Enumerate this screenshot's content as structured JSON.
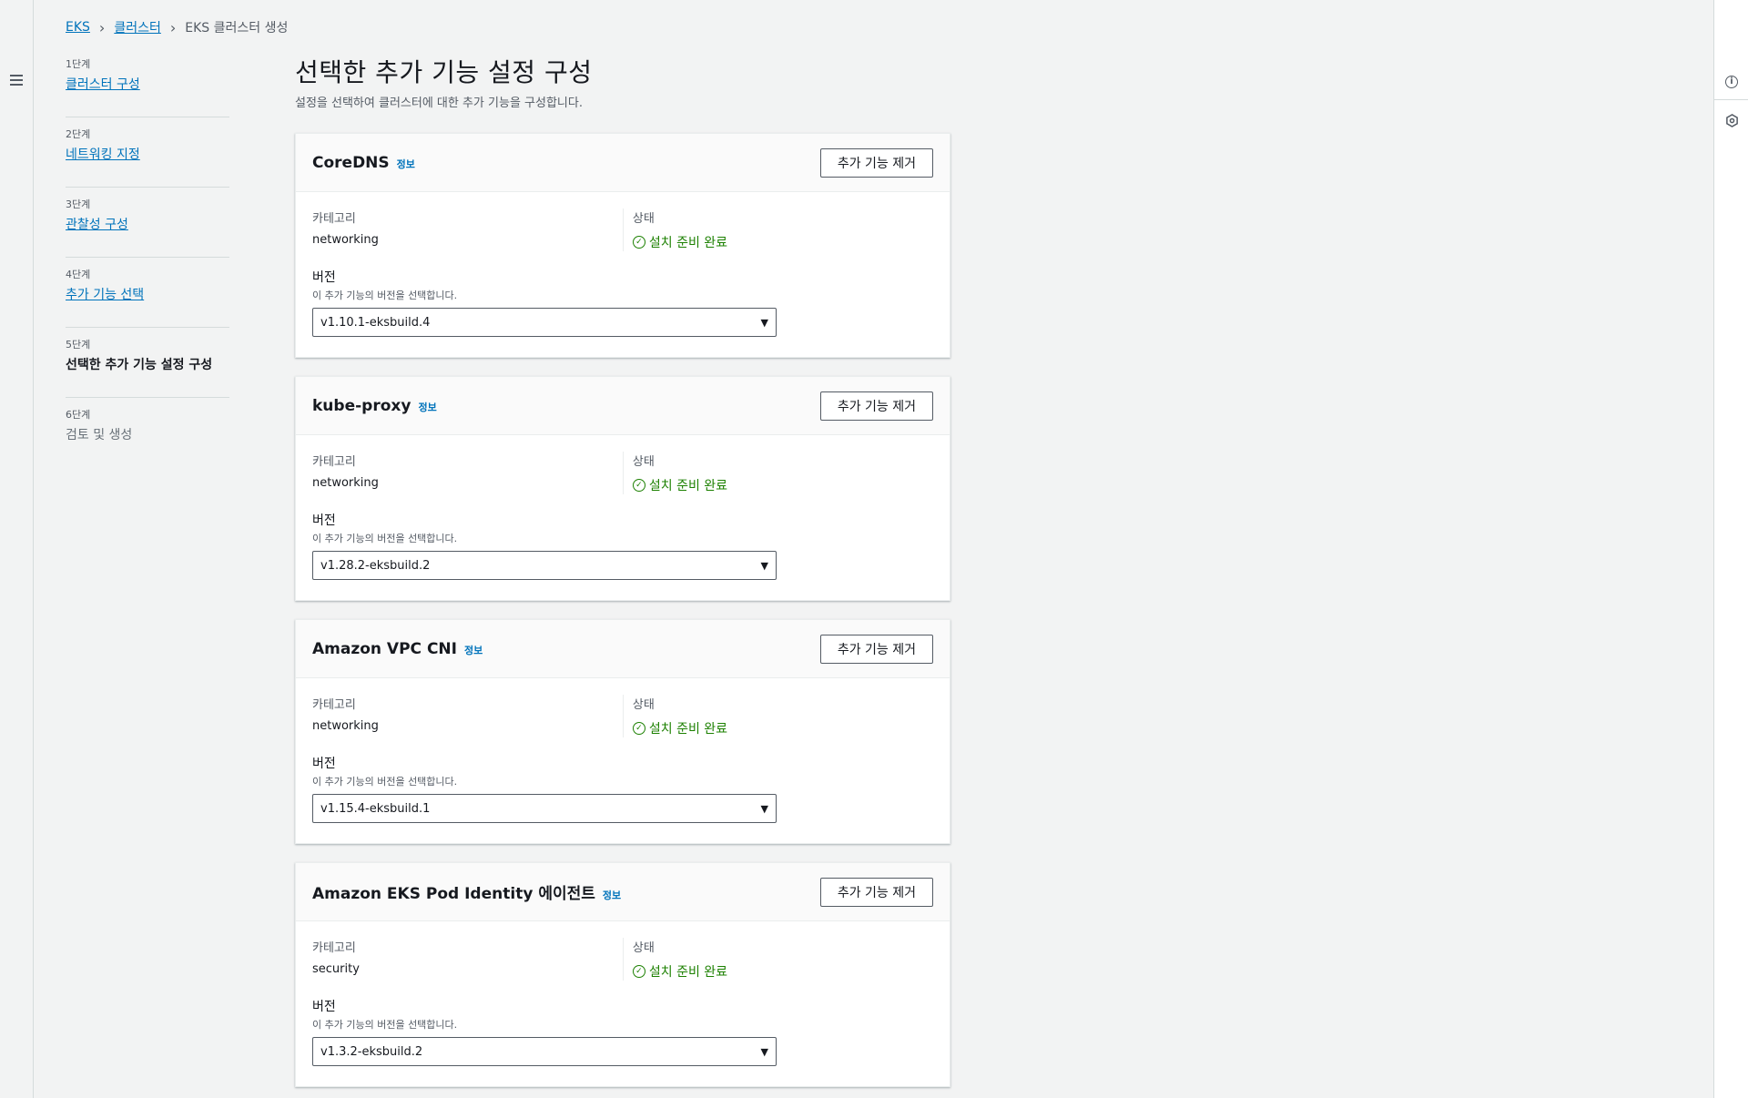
{
  "breadcrumb": {
    "items": [
      "EKS",
      "클러스터"
    ],
    "current": "EKS 클러스터 생성"
  },
  "steps": [
    {
      "num": "1단계",
      "label": "클러스터 구성",
      "state": "link"
    },
    {
      "num": "2단계",
      "label": "네트워킹 지정",
      "state": "link"
    },
    {
      "num": "3단계",
      "label": "관찰성 구성",
      "state": "link"
    },
    {
      "num": "4단계",
      "label": "추가 기능 선택",
      "state": "link"
    },
    {
      "num": "5단계",
      "label": "선택한 추가 기능 설정 구성",
      "state": "current"
    },
    {
      "num": "6단계",
      "label": "검토 및 생성",
      "state": "disabled"
    }
  ],
  "page": {
    "title": "선택한 추가 기능 설정 구성",
    "description": "설정을 선택하여 클러스터에 대한 추가 기능을 구성합니다."
  },
  "labels": {
    "info": "정보",
    "remove": "추가 기능 제거",
    "category": "카테고리",
    "status": "상태",
    "version": "버전",
    "version_desc": "이 추가 기능의 버전을 선택합니다."
  },
  "addons": [
    {
      "name": "CoreDNS",
      "category": "networking",
      "status": "설치 준비 완료",
      "version": "v1.10.1-eksbuild.4"
    },
    {
      "name": "kube-proxy",
      "category": "networking",
      "status": "설치 준비 완료",
      "version": "v1.28.2-eksbuild.2"
    },
    {
      "name": "Amazon VPC CNI",
      "category": "networking",
      "status": "설치 준비 완료",
      "version": "v1.15.4-eksbuild.1"
    },
    {
      "name": "Amazon EKS Pod Identity 에이전트",
      "category": "security",
      "status": "설치 준비 완료",
      "version": "v1.3.2-eksbuild.2"
    }
  ],
  "colors": {
    "link": "#0073bb",
    "success": "#1d8102",
    "background": "#f2f3f3"
  }
}
